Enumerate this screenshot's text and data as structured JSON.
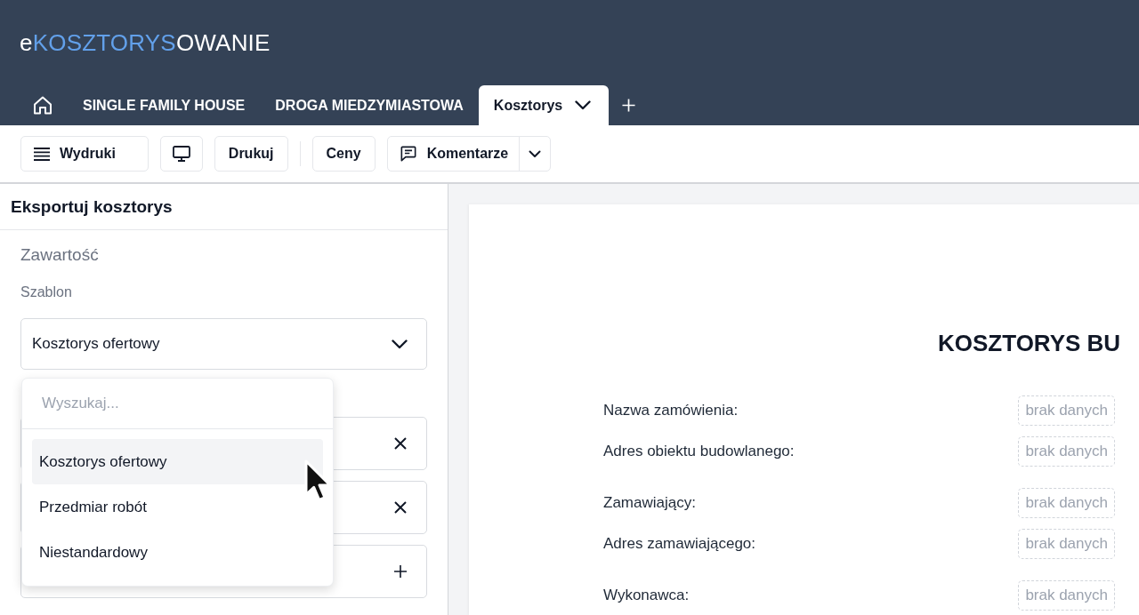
{
  "header": {
    "logo": [
      {
        "text": "e",
        "accent": false
      },
      {
        "text": "KOSZTORYS",
        "accent": true
      },
      {
        "text": "OWANIE",
        "accent": false
      }
    ]
  },
  "tabs": [
    {
      "kind": "home",
      "selected": false
    },
    {
      "kind": "text",
      "label": "SINGLE FAMILY HOUSE",
      "selected": false
    },
    {
      "kind": "text",
      "label": "DROGA MIEDZYMIASTOWA",
      "selected": false
    },
    {
      "kind": "menu",
      "label": "Kosztorys",
      "selected": true
    }
  ],
  "toolbar": {
    "groups": [
      [
        {
          "kind": "lines",
          "label": "Wydruki"
        },
        {
          "kind": "monitor"
        },
        {
          "kind": "text",
          "label": "Drukuj"
        }
      ],
      [
        {
          "kind": "text",
          "label": "Ceny"
        },
        {
          "kind": "comments",
          "label": "Komentarze"
        }
      ]
    ]
  },
  "export_panel": {
    "title": "Eksportuj kosztorys",
    "section": "Zawartość",
    "template_label": "Szablon",
    "template_select": {
      "value": "Kosztorys ofertowy",
      "expanded": true,
      "search_placeholder": "Wyszukaj...",
      "options": [
        {
          "label": "Kosztorys ofertowy",
          "selected": true
        },
        {
          "label": "Przedmiar robót",
          "selected": false
        },
        {
          "label": "Niestandardowy",
          "selected": false
        }
      ]
    },
    "fields": [
      {
        "kind": "remove"
      },
      {
        "kind": "remove"
      },
      {
        "kind": "add"
      }
    ]
  },
  "document": {
    "title": "KOSZTORYS BU",
    "groups": [
      [
        {
          "label": "Nazwa zamówienia:",
          "value": "brak danych"
        },
        {
          "label": "Adres obiektu budowlanego:",
          "value": "brak danych"
        }
      ],
      [
        {
          "label": "Zamawiający:",
          "value": "brak danych"
        },
        {
          "label": "Adres zamawiającego:",
          "value": "brak danych"
        }
      ],
      [
        {
          "label": "Wykonawca:",
          "value": "brak danych"
        }
      ]
    ]
  }
}
